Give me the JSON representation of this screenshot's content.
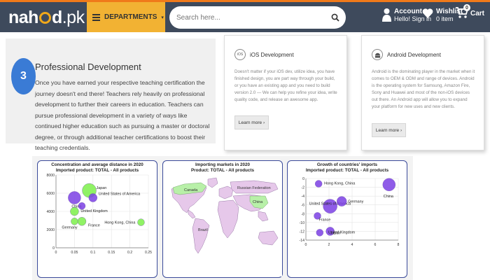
{
  "header": {
    "logo": {
      "pre": "nah",
      "post": "d",
      "tld": ".pk"
    },
    "departments_label": "DEPARTMENTS",
    "search_placeholder": "Search here...",
    "account": {
      "title": "Account",
      "subtitle": "Hello! Sign in"
    },
    "wishlist": {
      "title": "Wishlist",
      "subtitle": "0 item",
      "count": "0"
    },
    "cart": {
      "label": "Cart"
    },
    "colors": {
      "bar": "#3e4a5c",
      "accent": "#f07a1a",
      "departments": "#f2b233"
    }
  },
  "professional": {
    "number": "3",
    "title": "Professional Development",
    "text": "Once you have earned your respective teaching certification the journey doesn't end there! Teachers rely heavily on professional development to further their careers in education. Teachers can pursue professional development in a variety of ways like continued higher education such as pursuing a master or doctoral degree, or through additional teacher certifications to boost their teaching credentials."
  },
  "cards": [
    {
      "icon": "iOS",
      "title": "iOS Development",
      "body": "Doesn't matter if your iOS dev, utilize idea, you have finished design, you are part way through your build, or you have an existing app and you need to build version 2.0 — We can help you refine your idea, write quality code, and release an awesome app.",
      "button": "Learn more"
    },
    {
      "icon": "android-icon",
      "title": "Android Development",
      "body": "Android is the dominating player in the market when it comes to OEM & ODM and range of devices. Android is the operating system for Samsung, Amazon Fire, Sony and Huawei and most of the non-iOS devices out there. An Android app will allow you to expand your platform for new uses and new clients.",
      "button": "Learn more"
    }
  ],
  "chart_data": [
    {
      "type": "scatter",
      "title": "Concentration and average distance in 2020",
      "subtitle": "Imported product: TOTAL - All products",
      "xlim": [
        0,
        0.25
      ],
      "ylim": [
        0,
        8000
      ],
      "xticks": [
        "0",
        "0.05",
        "0.1",
        "0.15",
        "0.2",
        "0.25"
      ],
      "yticks": [
        "0",
        "2000",
        "4000",
        "6000",
        "8000"
      ],
      "points": [
        {
          "name": "Japan",
          "x": 0.09,
          "y": 6300,
          "color": "#7cf04a"
        },
        {
          "name": "United States of America",
          "x": 0.1,
          "y": 5500,
          "color": "#7b3fe4"
        },
        {
          "name": "China",
          "x": 0.05,
          "y": 5500,
          "color": "#7b3fe4"
        },
        {
          "name": "",
          "x": 0.07,
          "y": 4600,
          "color": "#7b3fe4"
        },
        {
          "name": "United Kingdom",
          "x": 0.05,
          "y": 4000,
          "color": "#7cf04a"
        },
        {
          "name": "Germany",
          "x": 0.05,
          "y": 2900,
          "color": "#7cf04a"
        },
        {
          "name": "France",
          "x": 0.07,
          "y": 2900,
          "color": "#7cf04a"
        },
        {
          "name": "Hong Kong, China",
          "x": 0.23,
          "y": 2800,
          "color": "#7cf04a"
        }
      ]
    },
    {
      "type": "map",
      "title": "Importing markets in 2020",
      "subtitle": "Product: TOTAL - All products",
      "labels": [
        "Canada",
        "Russian Federation",
        "China",
        "Brazil"
      ]
    },
    {
      "type": "scatter",
      "title": "Growth of countries' imports",
      "subtitle": "Imported product: TOTAL - All products",
      "xlim": [
        0,
        8
      ],
      "ylim": [
        -14,
        0
      ],
      "xticks": [
        "0",
        "2",
        "4",
        "6",
        "8"
      ],
      "yticks": [
        "0",
        "-2",
        "-4",
        "-6",
        "-8",
        "-10",
        "-12",
        "-14"
      ],
      "points": [
        {
          "name": "Hong Kong, China",
          "x": 1.1,
          "y": -1.2,
          "color": "#7b3fe4"
        },
        {
          "name": "China",
          "x": 7.2,
          "y": -1.4,
          "color": "#7b3fe4"
        },
        {
          "name": "United States of America",
          "x": 2.1,
          "y": -6.3,
          "color": "#7b3fe4"
        },
        {
          "name": "Germany",
          "x": 3.1,
          "y": -5.2,
          "color": "#7b3fe4"
        },
        {
          "name": "France",
          "x": 1.0,
          "y": -8.5,
          "color": "#7b3fe4"
        },
        {
          "name": "Japan",
          "x": 2.1,
          "y": -12.0,
          "color": "#7b3fe4"
        },
        {
          "name": "United Kingdom",
          "x": 1.2,
          "y": -12.3,
          "color": "#7b3fe4"
        }
      ]
    }
  ]
}
